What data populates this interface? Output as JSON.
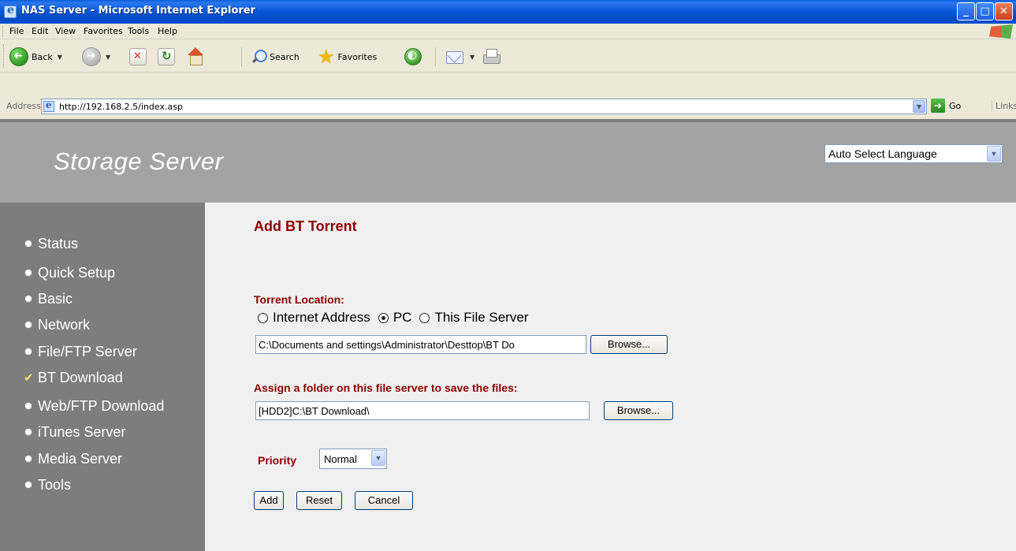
{
  "window": {
    "title": "NAS Server - Microsoft Internet Explorer",
    "controls": {
      "minimize": "_",
      "maximize": "□",
      "close": "✕"
    }
  },
  "menubar": {
    "items": [
      "File",
      "Edit",
      "View",
      "Favorites",
      "Tools",
      "Help"
    ]
  },
  "toolbar": {
    "back_label": "Back",
    "search_label": "Search",
    "favorites_label": "Favorites"
  },
  "addressbar": {
    "label": "Address",
    "url": "http://192.168.2.5/index.asp",
    "go_label": "Go",
    "links_label": "Links"
  },
  "header": {
    "site_title": "Storage Server",
    "language_select": "Auto Select Language"
  },
  "sidebar": {
    "items": [
      {
        "label": "Status",
        "active": false
      },
      {
        "label": "Quick Setup",
        "active": false
      },
      {
        "label": "Basic",
        "active": false
      },
      {
        "label": "Network",
        "active": false
      },
      {
        "label": "File/FTP Server",
        "active": false
      },
      {
        "label": "BT Download",
        "active": true
      },
      {
        "label": "Web/FTP Download",
        "active": false
      },
      {
        "label": "iTunes Server",
        "active": false
      },
      {
        "label": "Media Server",
        "active": false
      },
      {
        "label": "Tools",
        "active": false
      }
    ]
  },
  "main": {
    "title": "Add BT Torrent",
    "torrent_location": {
      "label": "Torrent Location:",
      "options": [
        "Internet Address",
        "PC",
        "This File Server"
      ],
      "selected": "PC",
      "path_value": "C:\\Documents and settings\\Administrator\\Desttop\\BT Do",
      "browse_label": "Browse..."
    },
    "save_folder": {
      "label": "Assign a folder on this file server to save the files:",
      "path_value": "[HDD2]C:\\BT Download\\",
      "browse_label": "Browse..."
    },
    "priority": {
      "label": "Priority",
      "value": "Normal"
    },
    "actions": {
      "add_label": "Add",
      "reset_label": "Reset",
      "cancel_label": "Cancel"
    }
  },
  "colors": {
    "title_red": "#8b0000",
    "sidebar_bg": "#7d7d7d",
    "header_bg": "#a3a3a3",
    "main_bg": "#f0f0f0"
  }
}
